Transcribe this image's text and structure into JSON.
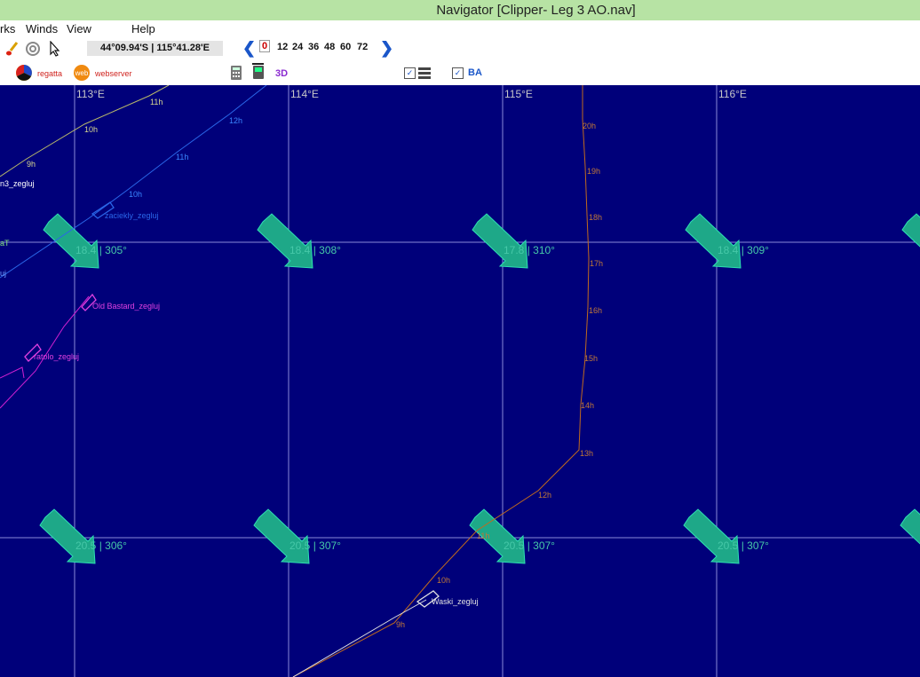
{
  "window": {
    "title": "Navigator [Clipper- Leg 3 AO.nav]"
  },
  "menu": [
    "rks",
    "Winds",
    "View",
    "Help"
  ],
  "toolbar": {
    "coordinates": "44°09.94'S | 115°41.28'E",
    "hours": [
      "0",
      "12",
      "24",
      "36",
      "48",
      "60",
      "72"
    ],
    "selected_hour": "0",
    "regatta_label": "regatta",
    "webserver_label": "webserver",
    "webserver_icon_text": "web",
    "view3d_label": "3D",
    "ba_label": "BA"
  },
  "map": {
    "longitude_labels": [
      "113°E",
      "114°E",
      "115°E",
      "116°E"
    ],
    "wind_labels": [
      "18.4 | 305°",
      "18.4 | 308°",
      "17.8 | 310°",
      "18.4 | 309°",
      "20.5 | 306°",
      "20.5 | 307°",
      "20.5 | 307°",
      "20.5 | 307°"
    ],
    "boats": [
      "Old Bastard_zegluj",
      "ratolo_zegluj",
      "Waski_zegluj",
      "zaciekly_zegluj",
      "n3_zegluj",
      "aT",
      "uj"
    ],
    "hour_marks_tan": [
      "9h",
      "10h",
      "11h"
    ],
    "hour_marks_blue": [
      "10h",
      "11h",
      "12h"
    ],
    "hour_marks_orange": [
      "20h",
      "19h",
      "18h",
      "17h",
      "16h",
      "15h",
      "14h",
      "13h",
      "12h",
      "11h",
      "10h",
      "9h"
    ],
    "colors": {
      "sea": "#00007a",
      "grid": "#8a8ad8",
      "wind_arrow": "#1ea888",
      "route_orange": "#c06a1e",
      "route_blue": "#2a66e8",
      "route_tan": "#b8b86a",
      "boat_magenta": "#d020d0",
      "boat_white": "#e0e0e0"
    }
  }
}
